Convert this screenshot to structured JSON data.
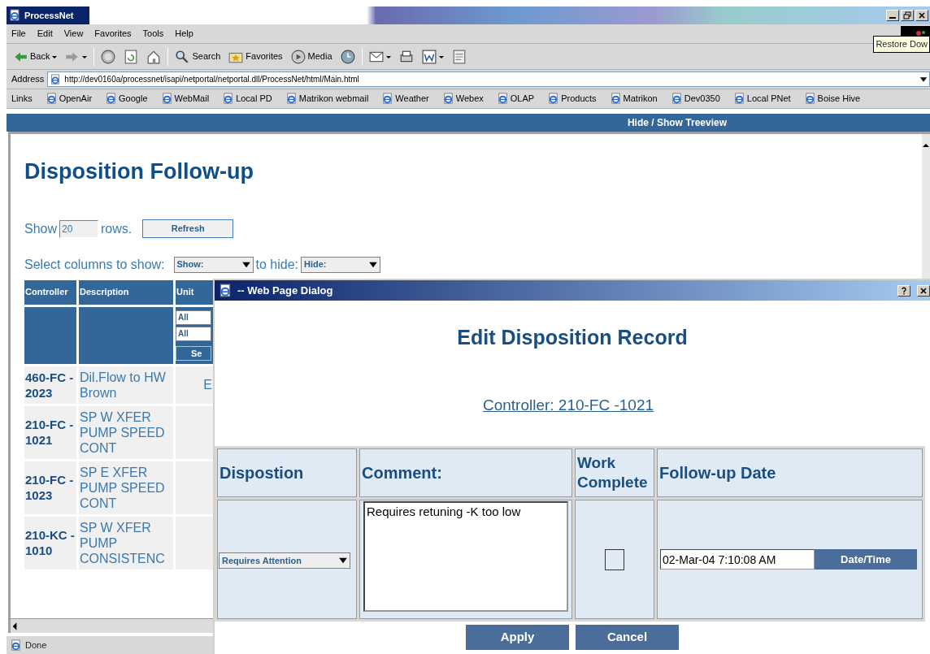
{
  "window": {
    "title": "ProcessNet"
  },
  "tooltip": "Restore Dow",
  "menu": [
    "File",
    "Edit",
    "View",
    "Favorites",
    "Tools",
    "Help"
  ],
  "toolbar": [
    {
      "label": "Back",
      "dropdown": true
    },
    {
      "dropdown": true
    },
    {
      "dropdown": false
    },
    {
      "dropdown": false
    },
    {
      "dropdown": false
    },
    {
      "label": "Search",
      "dropdown": false
    },
    {
      "label": "Favorites",
      "dropdown": false
    },
    {
      "label": "Media",
      "dropdown": false
    },
    {
      "dropdown": false
    },
    {
      "dropdown": true
    },
    {
      "dropdown": false
    },
    {
      "dropdown": true
    },
    {
      "dropdown": false
    }
  ],
  "address": {
    "label": "Address",
    "url": "http://dev0160a/processnet/isapi/netportal/netportal.dll/ProcessNet/html/Main.html"
  },
  "links": {
    "label": "Links",
    "items": [
      "OpenAir",
      "Google",
      "WebMail",
      "Local PD",
      "Matrikon webmail",
      "Weather",
      "Webex",
      "OLAP",
      "Products",
      "Matrikon",
      "Dev0350",
      "Local PNet",
      "Boise Hive"
    ]
  },
  "treeview_toggle": "Hide / Show Treeview",
  "page": {
    "title": "Disposition Follow-up",
    "rows_prefix": "Show",
    "rows_value": "20",
    "rows_suffix": "rows.",
    "refresh": "Refresh",
    "columns_label": "Select columns to show:",
    "show_select": "Show:",
    "hide_label": "to hide:",
    "hide_select": "Hide:",
    "table": {
      "columns": [
        "Controller",
        "Description",
        "Unit"
      ],
      "filters": [
        "All",
        "All"
      ],
      "filter_button": "Se",
      "rows": [
        {
          "controller": "460-FC - 2023",
          "description": "Dil.Flow to HW Brown",
          "unit": "E"
        },
        {
          "controller": "210-FC - 1021",
          "description": "SP W XFER PUMP SPEED CONT"
        },
        {
          "controller": "210-FC - 1023",
          "description": "SP E XFER PUMP SPEED CONT"
        },
        {
          "controller": "210-KC - 1010",
          "description": "SP W XFER PUMP CONSISTENC"
        }
      ]
    }
  },
  "status": "Done",
  "dialog": {
    "title": "-- Web Page Dialog",
    "heading": "Edit Disposition Record",
    "controller_link": "Controller: 210-FC -1021",
    "columns": [
      "Dispostion",
      "Comment:",
      "Work Complete",
      "Follow-up Date"
    ],
    "disposition": "Requires Attention",
    "comment": "Requires retuning -K too low",
    "work_complete": false,
    "follow_up_date": "02-Mar-04 7:10:08 AM",
    "date_button": "Date/Time",
    "buttons": [
      "Apply",
      "Cancel"
    ]
  }
}
